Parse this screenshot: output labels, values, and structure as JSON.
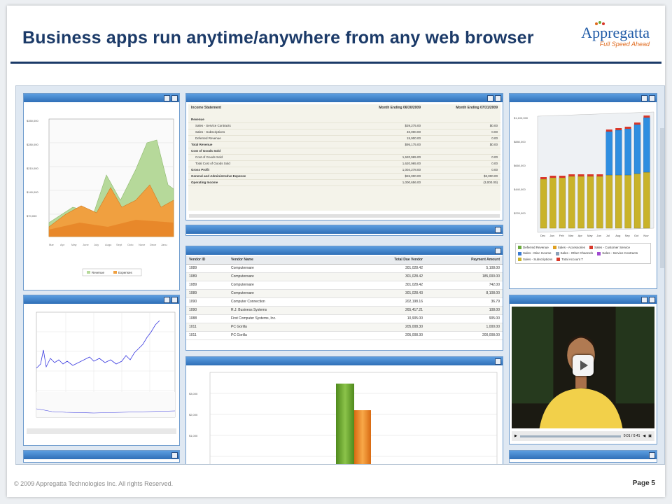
{
  "slide": {
    "title": "Business apps run anytime/anywhere from any web browser",
    "logo_name": "Appregatta",
    "logo_tagline": "Full Speed Ahead",
    "copyright": "© 2009 Appregatta Technologies Inc. All rights Reserved.",
    "page": "Page 5"
  },
  "colors": {
    "title": "#1b3a68",
    "portlet_bar": "#2f6fb7",
    "orange": "#f0962a",
    "green": "#a8d07a",
    "blue": "#2f8ee0",
    "gold": "#c9b32a"
  },
  "portlets": {
    "revenue_chart": {
      "legend": [
        "Revenue",
        "Expenses"
      ]
    },
    "income": {
      "header": "Income Statement",
      "col1": "Month Ending 06/30/2009",
      "col2": "Month Ending 07/31/2009",
      "rows": [
        {
          "label": "Revenue",
          "a": "",
          "b": ""
        },
        {
          "label": "Sales - Service Contracts",
          "a": "$39,275.00",
          "b": "$0.00"
        },
        {
          "label": "Sales - Subscriptions",
          "a": "40,000.00",
          "b": "0.00"
        },
        {
          "label": "Deferred Revenue",
          "a": "15,900.00",
          "b": "0.00"
        },
        {
          "label": "Total Revenue",
          "a": "$95,175.00",
          "b": "$0.00"
        },
        {
          "label": "Cost of Goods Sold",
          "a": "",
          "b": ""
        },
        {
          "label": "Cost of Goods Sold",
          "a": "1,620,965.00",
          "b": "0.00"
        },
        {
          "label": "Total Cost of Goods Sold",
          "a": "1,620,965.00",
          "b": "0.00"
        },
        {
          "label": "Gross Profit",
          "a": "1,004,278.00",
          "b": "0.00"
        },
        {
          "label": "General and Administrative Expense",
          "a": "$26,000.00",
          "b": "$3,000.00"
        },
        {
          "label": "Operating Income",
          "a": "1,000,656.00",
          "b": "(3,000.00)"
        }
      ]
    },
    "vendors": {
      "headers": [
        "Vendor ID",
        "Vendor Name",
        "Total Due Vendor",
        "Payment Amount"
      ],
      "rows": [
        [
          "1089",
          "Computerware",
          "301,028.42",
          "5,108.00"
        ],
        [
          "1089",
          "Computerware",
          "301,028.42",
          "185,000.00"
        ],
        [
          "1089",
          "Computerware",
          "301,028.42",
          "742.00"
        ],
        [
          "1089",
          "Computerware",
          "301,028.43",
          "8,108.00"
        ],
        [
          "1090",
          "Computer Connection",
          "202,198.16",
          "36.79"
        ],
        [
          "1090",
          "R.J. Business Systems",
          "265,417.21",
          "108.00"
        ],
        [
          "1088",
          "First Computer Systems, Inc.",
          "10,905.00",
          "905.00"
        ],
        [
          "1011",
          "PC Gorilla",
          "205,008.30",
          "1,000.00"
        ],
        [
          "1011",
          "PC Gorilla",
          "205,008.30",
          "200,008.00"
        ]
      ]
    },
    "stacked_chart": {
      "months": [
        "Dec",
        "Jan",
        "Feb",
        "Mar",
        "Apr",
        "May",
        "Jun",
        "Jul",
        "Aug",
        "Sep",
        "Oct",
        "Nov"
      ],
      "legend": [
        "Deferred Revenue",
        "Sales - Accessories",
        "Sales - Customer Service",
        "Sales - Misc Income",
        "Sales - Other Channels",
        "Sales - Service Contracts",
        "Sales - Subscriptions",
        "Total Account T"
      ]
    },
    "video": {
      "time": "0:01 / 0:41"
    }
  }
}
